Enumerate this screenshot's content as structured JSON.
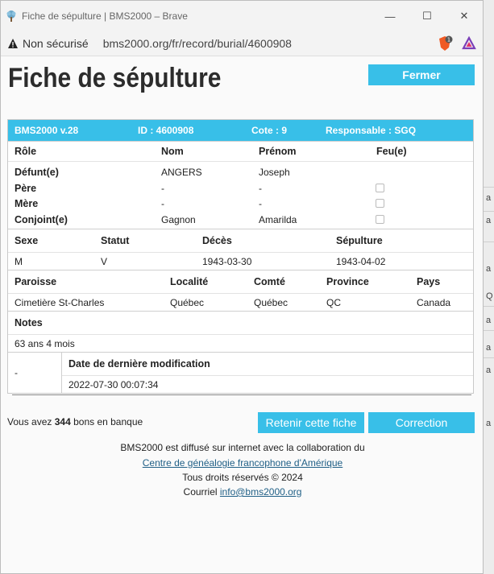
{
  "window": {
    "title": "Fiche de sépulture | BMS2000 – Brave",
    "minimize": "—",
    "maximize": "☐",
    "close": "✕"
  },
  "addressbar": {
    "security": "Non sécurisé",
    "url": "bms2000.org/fr/record/burial/4600908",
    "badge_count": "1"
  },
  "page": {
    "title": "Fiche de sépulture",
    "close_button": "Fermer"
  },
  "record_bar": {
    "version": "BMS2000 v.28",
    "id": "ID : 4600908",
    "cote": "Cote : 9",
    "responsable": "Responsable : SGQ"
  },
  "persons": {
    "headers": [
      "Rôle",
      "Nom",
      "Prénom",
      "Feu(e)"
    ],
    "rows": [
      {
        "role": "Défunt(e)",
        "nom": "ANGERS",
        "prenom": "Joseph",
        "checkbox": false
      },
      {
        "role": "Père",
        "nom": "-",
        "prenom": "-",
        "checkbox": true
      },
      {
        "role": "Mère",
        "nom": "-",
        "prenom": "-",
        "checkbox": true
      },
      {
        "role": "Conjoint(e)",
        "nom": "Gagnon",
        "prenom": "Amarilda",
        "checkbox": true
      }
    ]
  },
  "details": {
    "headers": [
      "Sexe",
      "Statut",
      "Décès",
      "Sépulture"
    ],
    "values": [
      "M",
      "V",
      "1943-03-30",
      "1943-04-02"
    ]
  },
  "location": {
    "headers": [
      "Paroisse",
      "Localité",
      "Comté",
      "Province",
      "Pays"
    ],
    "values": [
      "Cimetière St-Charles",
      "Québec",
      "Québec",
      "QC",
      "Canada"
    ]
  },
  "notes": {
    "header": "Notes",
    "value": "63 ans 4 mois"
  },
  "modification": {
    "left": "-",
    "header": "Date de dernière modification",
    "value": "2022-07-30 00:07:34"
  },
  "bank": {
    "prefix": "Vous avez",
    "count": "344",
    "suffix": "bons en banque"
  },
  "actions": {
    "retain": "Retenir cette fiche",
    "correction": "Correction"
  },
  "footer": {
    "line1": "BMS2000 est diffusé sur internet avec la collaboration du",
    "link": "Centre de généalogie francophone d'Amérique",
    "rights": "Tous droits réservés © 2024",
    "email_label": "Courriel",
    "email": "info@bms2000.org"
  },
  "background_panel": {
    "labels": [
      "a",
      "a",
      "a",
      "Q",
      "a",
      "a",
      "a",
      "a"
    ]
  }
}
